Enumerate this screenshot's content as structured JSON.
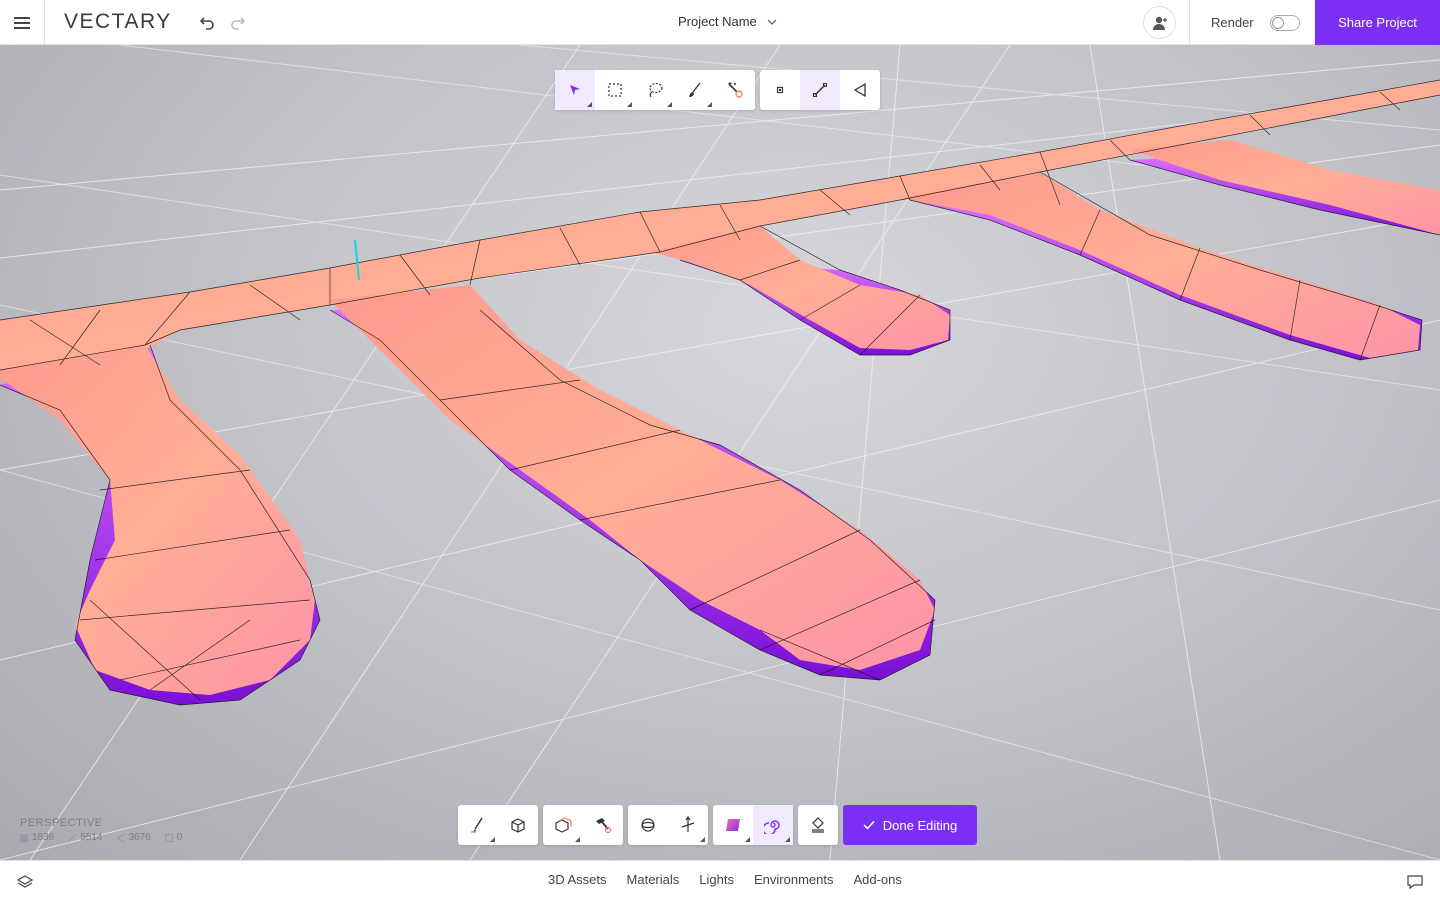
{
  "header": {
    "logo": "VECTARY",
    "project_name": "Project Name",
    "render_label": "Render",
    "share_label": "Share Project"
  },
  "top_tools": {
    "selection": [
      "select-arrow-icon",
      "box-select-icon",
      "lasso-select-icon",
      "paint-select-icon",
      "magic-select-icon"
    ],
    "mode": [
      "vertex-mode-icon",
      "edge-mode-icon",
      "face-mode-icon"
    ]
  },
  "bottom_tools": [
    "pen-icon",
    "cube-icon",
    "extrude-icon",
    "hammer-icon",
    "loop-icon",
    "axis-icon",
    "plane-icon",
    "spiral-icon",
    "stamp-icon"
  ],
  "done_label": "Done Editing",
  "stats": {
    "view": "PERSPECTIVE",
    "vertices": "1836",
    "edges": "5514",
    "faces": "3676",
    "objects": "0"
  },
  "bottom_nav": [
    "3D Assets",
    "Materials",
    "Lights",
    "Environments",
    "Add-ons"
  ],
  "colors": {
    "accent": "#7b2ff2",
    "mesh_top": "#ffa08f",
    "mesh_side": "#a025e0"
  }
}
